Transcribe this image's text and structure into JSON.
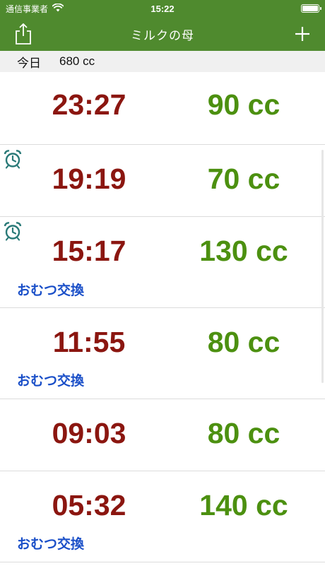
{
  "status_bar": {
    "carrier": "通信事業者",
    "time": "15:22",
    "wifi_icon": "wifi-icon",
    "battery_icon": "battery-icon"
  },
  "nav": {
    "title": "ミルクの母",
    "share_icon": "share-icon",
    "add_icon": "plus-icon"
  },
  "today": {
    "label": "今日",
    "total": "680 cc"
  },
  "entries": [
    {
      "time": "23:27",
      "amount": "90 cc",
      "alarm": false,
      "diaper": ""
    },
    {
      "time": "19:19",
      "amount": "70 cc",
      "alarm": true,
      "diaper": ""
    },
    {
      "time": "15:17",
      "amount": "130 cc",
      "alarm": true,
      "diaper": "おむつ交換"
    },
    {
      "time": "11:55",
      "amount": "80 cc",
      "alarm": false,
      "diaper": "おむつ交換"
    },
    {
      "time": "09:03",
      "amount": "80 cc",
      "alarm": false,
      "diaper": ""
    },
    {
      "time": "05:32",
      "amount": "140 cc",
      "alarm": false,
      "diaper": "おむつ交換"
    }
  ],
  "colors": {
    "nav_background": "#4f8a2e",
    "time_text": "#8b1610",
    "amount_text": "#4c9010",
    "diaper_text": "#1a4fc8",
    "alarm_icon": "#2a7a78"
  }
}
